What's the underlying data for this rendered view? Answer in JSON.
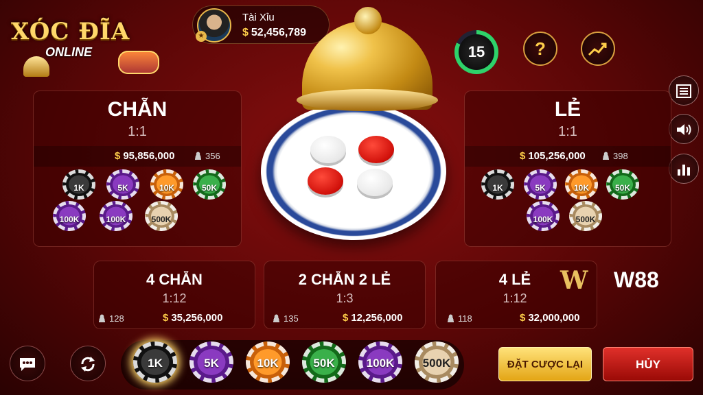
{
  "logo": {
    "title": "XÓC ĐĨA",
    "subtitle": "ONLINE"
  },
  "player": {
    "name": "Tài Xỉu",
    "currency": "$",
    "balance": "52,456,789"
  },
  "timer": {
    "value": "15",
    "remaining_fraction": 0.82
  },
  "top_buttons": {
    "help": "?",
    "trend": "trend-icon"
  },
  "side_buttons": [
    "menu-icon",
    "sound-icon",
    "stats-icon"
  ],
  "bowl": {
    "discs": [
      "white",
      "red",
      "red",
      "white"
    ]
  },
  "bets": {
    "chan": {
      "title": "CHẴN",
      "odds": "1:1",
      "money": "95,856,000",
      "players": "356"
    },
    "le": {
      "title": "LẺ",
      "odds": "1:1",
      "money": "105,256,000",
      "players": "398"
    },
    "four_chan": {
      "title": "4 CHẴN",
      "odds": "1:12",
      "money": "35,256,000",
      "players": "128"
    },
    "two_two": {
      "title": "2 CHẴN 2 LẺ",
      "odds": "1:3",
      "money": "12,256,000",
      "players": "135"
    },
    "four_le": {
      "title": "4 LẺ",
      "odds": "1:12",
      "money": "32,000,000",
      "players": "118"
    }
  },
  "panel_chips": [
    "1K",
    "5K",
    "10K",
    "50K",
    "100K",
    "100K",
    "500K"
  ],
  "right_panel_chips": [
    "1K",
    "5K",
    "10K",
    "50K",
    "100K",
    "500K"
  ],
  "chip_tray": [
    "1K",
    "5K",
    "10K",
    "50K",
    "100K",
    "500K"
  ],
  "selected_chip": "1K",
  "buttons": {
    "rebet": "ĐẶT CƯỢC LẠI",
    "cancel": "HỦY"
  },
  "brand": {
    "name": "W88",
    "mark": "W"
  },
  "currency_symbol": "$"
}
